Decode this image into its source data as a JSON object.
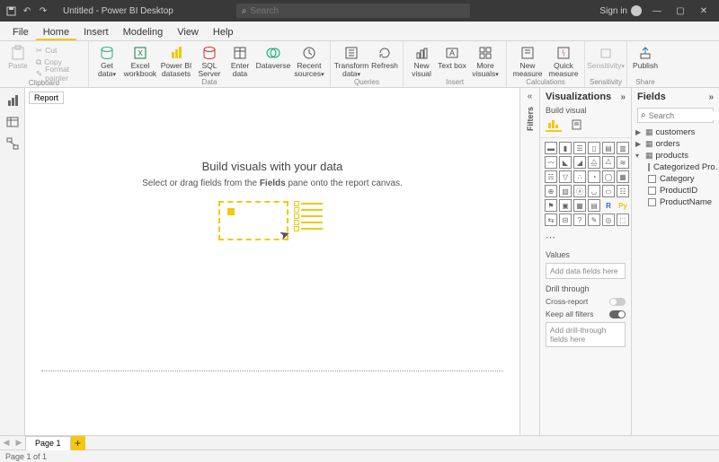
{
  "titlebar": {
    "title": "Untitled - Power BI Desktop",
    "search_placeholder": "Search",
    "signin": "Sign in"
  },
  "menus": [
    "File",
    "Home",
    "Insert",
    "Modeling",
    "View",
    "Help"
  ],
  "active_menu": "Home",
  "ribbon": {
    "clipboard": {
      "paste": "Paste",
      "cut": "Cut",
      "copy": "Copy",
      "format": "Format painter",
      "label": "Clipboard"
    },
    "data": {
      "get": "Get data",
      "excel": "Excel workbook",
      "pbi": "Power BI datasets",
      "sql": "SQL Server",
      "enter": "Enter data",
      "dataverse": "Dataverse",
      "recent": "Recent sources",
      "label": "Data"
    },
    "queries": {
      "transform": "Transform data",
      "refresh": "Refresh",
      "label": "Queries"
    },
    "insert": {
      "newvisual": "New visual",
      "textbox": "Text box",
      "more": "More visuals",
      "label": "Insert"
    },
    "calc": {
      "newmeasure": "New measure",
      "quick": "Quick measure",
      "label": "Calculations"
    },
    "sensitivity": {
      "btn": "Sensitivity",
      "label": "Sensitivity"
    },
    "share": {
      "publish": "Publish",
      "label": "Share"
    }
  },
  "report_tag": "Report",
  "placeholder": {
    "title": "Build visuals with your data",
    "sub_pre": "Select or drag fields from the ",
    "sub_bold": "Fields",
    "sub_post": " pane onto the report canvas."
  },
  "filters_label": "Filters",
  "viz": {
    "header": "Visualizations",
    "build": "Build visual",
    "values": "Values",
    "values_well": "Add data fields here",
    "drill": "Drill through",
    "cross": "Cross-report",
    "keep": "Keep all filters",
    "drill_well": "Add drill-through fields here"
  },
  "fields": {
    "header": "Fields",
    "search_placeholder": "Search",
    "tables": [
      {
        "name": "customers",
        "expanded": false
      },
      {
        "name": "orders",
        "expanded": false
      },
      {
        "name": "products",
        "expanded": true,
        "cols": [
          "Categorized Pro…",
          "Category",
          "ProductID",
          "ProductName"
        ]
      }
    ]
  },
  "page_tab": "Page 1",
  "status": "Page 1 of 1"
}
